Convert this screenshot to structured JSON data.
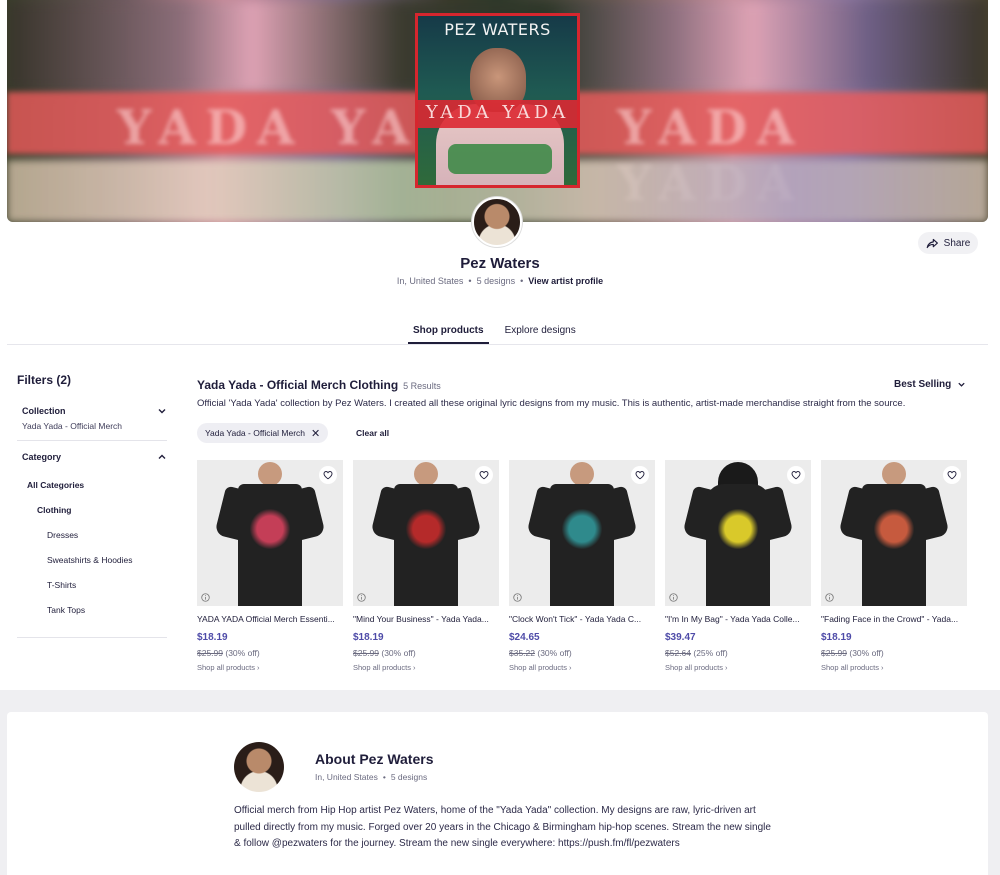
{
  "banner": {
    "cover_artist": "PEZ WATERS",
    "cover_title": "YADA YADA",
    "blur_text": "YADA YADA"
  },
  "profile": {
    "name": "Pez Waters",
    "location": "In, United States",
    "designs": "5 designs",
    "view_link": "View artist profile",
    "share_label": "Share"
  },
  "tabs": [
    {
      "label": "Shop products",
      "active": true
    },
    {
      "label": "Explore designs",
      "active": false
    }
  ],
  "filters": {
    "title": "Filters (2)",
    "collection": {
      "label": "Collection",
      "value": "Yada Yada - Official Merch"
    },
    "category": {
      "label": "Category",
      "all": "All Categories",
      "clothing": "Clothing",
      "items": [
        "Dresses",
        "Sweatshirts & Hoodies",
        "T-Shirts",
        "Tank Tops"
      ]
    }
  },
  "results": {
    "title": "Yada Yada - Official Merch Clothing",
    "count": "5 Results",
    "sort": "Best Selling",
    "description": "Official 'Yada Yada' collection by Pez Waters. I created all these original lyric designs from my music. This is authentic, artist-made merchandise straight from the source.",
    "chip": "Yada Yada - Official Merch",
    "clear_all": "Clear all"
  },
  "products": [
    {
      "name": "YADA YADA Official Merch Essenti...",
      "price": "$18.19",
      "orig": "$25.99",
      "discount": "(30% off)",
      "shop": "Shop all products ›",
      "print_color": "#c43e57",
      "kind": "tee"
    },
    {
      "name": "\"Mind Your Business\" - Yada Yada...",
      "price": "$18.19",
      "orig": "$25.99",
      "discount": "(30% off)",
      "shop": "Shop all products ›",
      "print_color": "#b52a2a",
      "kind": "tee"
    },
    {
      "name": "\"Clock Won't Tick\" - Yada Yada C...",
      "price": "$24.65",
      "orig": "$35.22",
      "discount": "(30% off)",
      "shop": "Shop all products ›",
      "print_color": "#2f8a8c",
      "kind": "tee"
    },
    {
      "name": "\"I'm In My Bag\" - Yada Yada Colle...",
      "price": "$39.47",
      "orig": "$52.64",
      "discount": "(25% off)",
      "shop": "Shop all products ›",
      "print_color": "#d9c92a",
      "kind": "hoodie"
    },
    {
      "name": "\"Fading Face in the Crowd\" - Yada...",
      "price": "$18.19",
      "orig": "$25.99",
      "discount": "(30% off)",
      "shop": "Shop all products ›",
      "print_color": "#c65a3e",
      "kind": "tee"
    }
  ],
  "about": {
    "title": "About Pez Waters",
    "location": "In, United States",
    "designs": "5 designs",
    "text": "Official merch from Hip Hop artist Pez Waters, home of the \"Yada Yada\" collection. My designs are raw, lyric-driven art pulled directly from my music. Forged over 20 years in the Chicago & Birmingham hip-hop scenes. Stream the new single & follow @pezwaters for the journey. Stream the new single everywhere: https://push.fm/fl/pezwaters"
  }
}
